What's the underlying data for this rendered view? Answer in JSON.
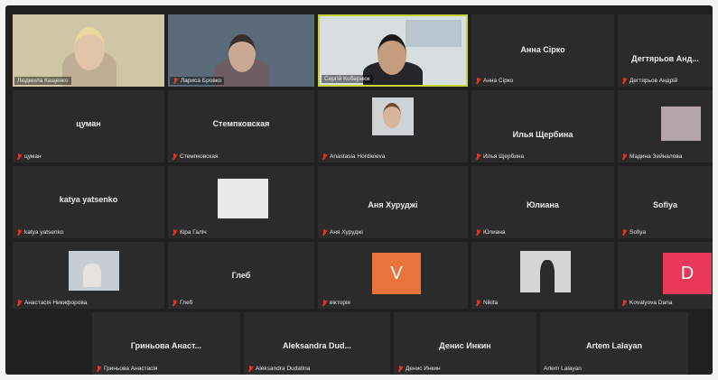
{
  "participants": {
    "lyudmyla": {
      "label": "Людмила Кащенко"
    },
    "larysa": {
      "label": "Лариса Бровко"
    },
    "serhii": {
      "label": "Сергій  Кобернюк"
    },
    "anna_sirko": {
      "center": "Анна Сірко",
      "label": "Анна Сірко"
    },
    "dehtiarov": {
      "center": "Дегтярьов  Анд...",
      "label": "Дегтярьов Андрій"
    },
    "tsuman": {
      "center": "цуман",
      "label": "цуман"
    },
    "stempkovskaya": {
      "center": "Стемпковская",
      "label": "Стемпковская"
    },
    "hordieieva": {
      "label": "Anastasia Hordieieva"
    },
    "shcherbyna": {
      "center": "Илья Щербина",
      "label": "Илья Щербина"
    },
    "zeinalova": {
      "label": "Мадина Зейналова"
    },
    "yatsenko": {
      "center": "katya yatsenko",
      "label": "katya yatsenko"
    },
    "halich": {
      "label": "Кіра Галіч"
    },
    "khurudzhi": {
      "center": "Аня Хуруджі",
      "label": "Аня Хуруджі"
    },
    "yuliana": {
      "center": "Юлиана",
      "label": "Юлиана"
    },
    "sofiya": {
      "center": "Sofiya",
      "label": "Sofiya"
    },
    "nykyforova": {
      "label": "Анастасія Никифорова"
    },
    "gleb": {
      "center": "Глеб",
      "label": "Глеб"
    },
    "viktoriya": {
      "avatar": "V",
      "label": "вікторія"
    },
    "nikita": {
      "label": "Nikita"
    },
    "kovalyova": {
      "avatar": "D",
      "label": "Kovalyova Daria"
    },
    "hrynova": {
      "center": "Гриньова  Анаст...",
      "label": "Гриньова Анастасія"
    },
    "dudatina": {
      "center": "Aleksandra  Dud...",
      "label": "Aleksandra Dudatina"
    },
    "inkin": {
      "center": "Денис Инкин",
      "label": "Денис Инкин"
    },
    "lalayan": {
      "center": "Artem Lalayan",
      "label": "Artem Lalayan"
    }
  },
  "colors": {
    "tile_bg": "#2b2b2b",
    "active_speaker_border": "#c6d437",
    "muted_icon": "#e0342a",
    "avatar_v": "#e8743b",
    "avatar_d": "#e8395a"
  },
  "icons": {
    "muted": "microphone-muted-icon"
  }
}
